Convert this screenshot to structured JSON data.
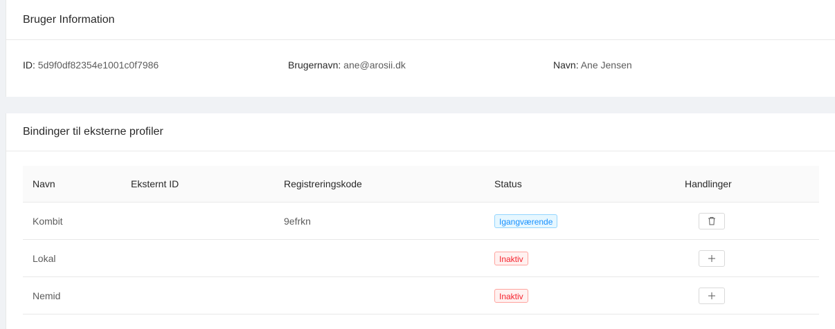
{
  "user_card": {
    "title": "Bruger Information",
    "id_label": "ID",
    "id_value": "5d9f0df82354e1001c0f7986",
    "username_label": "Brugernavn",
    "username_value": "ane@arosii.dk",
    "name_label": "Navn",
    "name_value": "Ane Jensen",
    "separator": ":"
  },
  "bindings_card": {
    "title": "Bindinger til eksterne profiler",
    "columns": [
      "Navn",
      "Eksternt ID",
      "Registreringskode",
      "Status",
      "Handlinger"
    ],
    "rows": [
      {
        "name": "Kombit",
        "external_id": "",
        "registration_code": "9efrkn",
        "status": "Igangværende",
        "status_color": "#1890ff",
        "action_icon": "delete-icon"
      },
      {
        "name": "Lokal",
        "external_id": "",
        "registration_code": "",
        "status": "Inaktiv",
        "status_color": "#f5222d",
        "action_icon": "plus-icon"
      },
      {
        "name": "Nemid",
        "external_id": "",
        "registration_code": "",
        "status": "Inaktiv",
        "status_color": "#f5222d",
        "action_icon": "plus-icon"
      }
    ]
  },
  "colors": {
    "page_background": "#f0f2f5",
    "card_background": "#ffffff",
    "border": "#e8e8e8",
    "tag_blue": "#1890ff",
    "tag_red": "#f5222d"
  }
}
